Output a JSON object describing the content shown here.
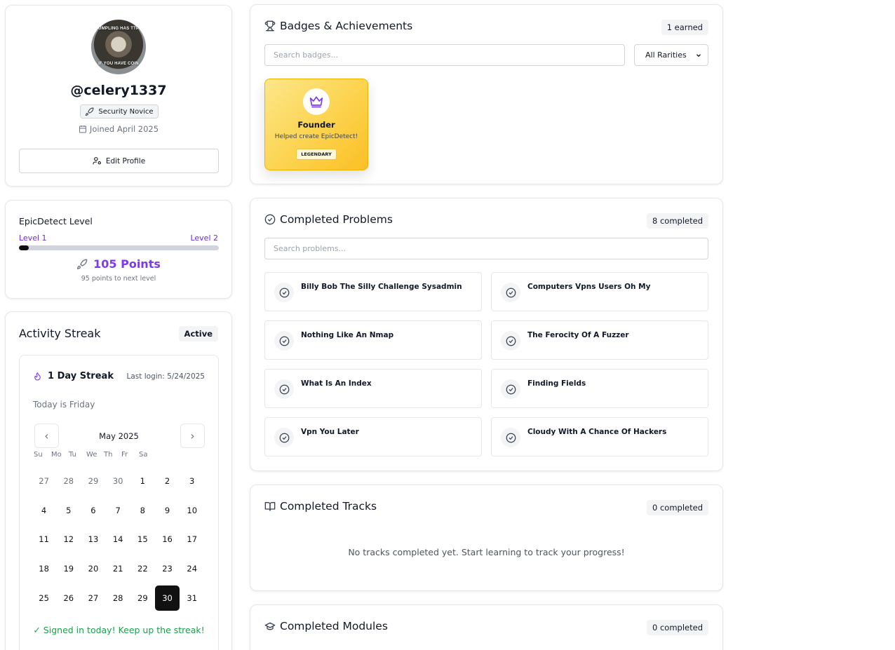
{
  "profile": {
    "avatar_caption_top": "DUMPLING HAS TTPS",
    "avatar_caption_bottom": "IF YOU HAVE COIN",
    "username": "@celery1337",
    "rank": "Security Novice",
    "joined": "Joined April 2025",
    "edit_label": "Edit Profile"
  },
  "level": {
    "title": "EpicDetect Level",
    "current": "Level 1",
    "next": "Level 2",
    "progress_fraction": 0.05,
    "points": "105 Points",
    "to_next": "95 points to next level"
  },
  "streak": {
    "title": "Activity Streak",
    "status": "Active",
    "days_label": "1 Day Streak",
    "last_login": "Last login: 5/24/2025",
    "today": "Today is Friday",
    "month": "May 2025",
    "weekdays": [
      "Su",
      "Mo",
      "Tu",
      "We",
      "Th",
      "Fr",
      "Sa"
    ],
    "days": [
      {
        "d": "27",
        "m": true
      },
      {
        "d": "28",
        "m": true
      },
      {
        "d": "29",
        "m": true
      },
      {
        "d": "30",
        "m": true
      },
      {
        "d": "1"
      },
      {
        "d": "2"
      },
      {
        "d": "3"
      },
      {
        "d": "4"
      },
      {
        "d": "5"
      },
      {
        "d": "6"
      },
      {
        "d": "7"
      },
      {
        "d": "8"
      },
      {
        "d": "9"
      },
      {
        "d": "10"
      },
      {
        "d": "11"
      },
      {
        "d": "12"
      },
      {
        "d": "13"
      },
      {
        "d": "14"
      },
      {
        "d": "15"
      },
      {
        "d": "16"
      },
      {
        "d": "17"
      },
      {
        "d": "18"
      },
      {
        "d": "19"
      },
      {
        "d": "20"
      },
      {
        "d": "21"
      },
      {
        "d": "22"
      },
      {
        "d": "23"
      },
      {
        "d": "24"
      },
      {
        "d": "25"
      },
      {
        "d": "26"
      },
      {
        "d": "27"
      },
      {
        "d": "28"
      },
      {
        "d": "29"
      },
      {
        "d": "30",
        "sel": true
      },
      {
        "d": "31"
      }
    ],
    "signed_msg": "✓ Signed in today! Keep up the streak!"
  },
  "badges": {
    "title": "Badges & Achievements",
    "count": "1 earned",
    "search_placeholder": "Search badges...",
    "rarity_filter": "All Rarities",
    "items": [
      {
        "name": "Founder",
        "desc": "Helped create EpicDetect!",
        "rarity": "LEGENDARY",
        "icon": "crown-icon"
      }
    ]
  },
  "problems": {
    "title": "Completed Problems",
    "count": "8 completed",
    "search_placeholder": "Search problems...",
    "items": [
      "Billy Bob The Silly Challenge Sysadmin",
      "Computers Vpns Users Oh My",
      "Nothing Like An Nmap",
      "The Ferocity Of A Fuzzer",
      "What Is An Index",
      "Finding Fields",
      "Vpn You Later",
      "Cloudy With A Chance Of Hackers"
    ]
  },
  "tracks": {
    "title": "Completed Tracks",
    "count": "0 completed",
    "empty": "No tracks completed yet. Start learning to track your progress!"
  },
  "modules": {
    "title": "Completed Modules",
    "count": "0 completed"
  },
  "colors": {
    "accent": "#7c3aed",
    "success": "#16a34a",
    "badge_gold": "#fcd34d"
  }
}
